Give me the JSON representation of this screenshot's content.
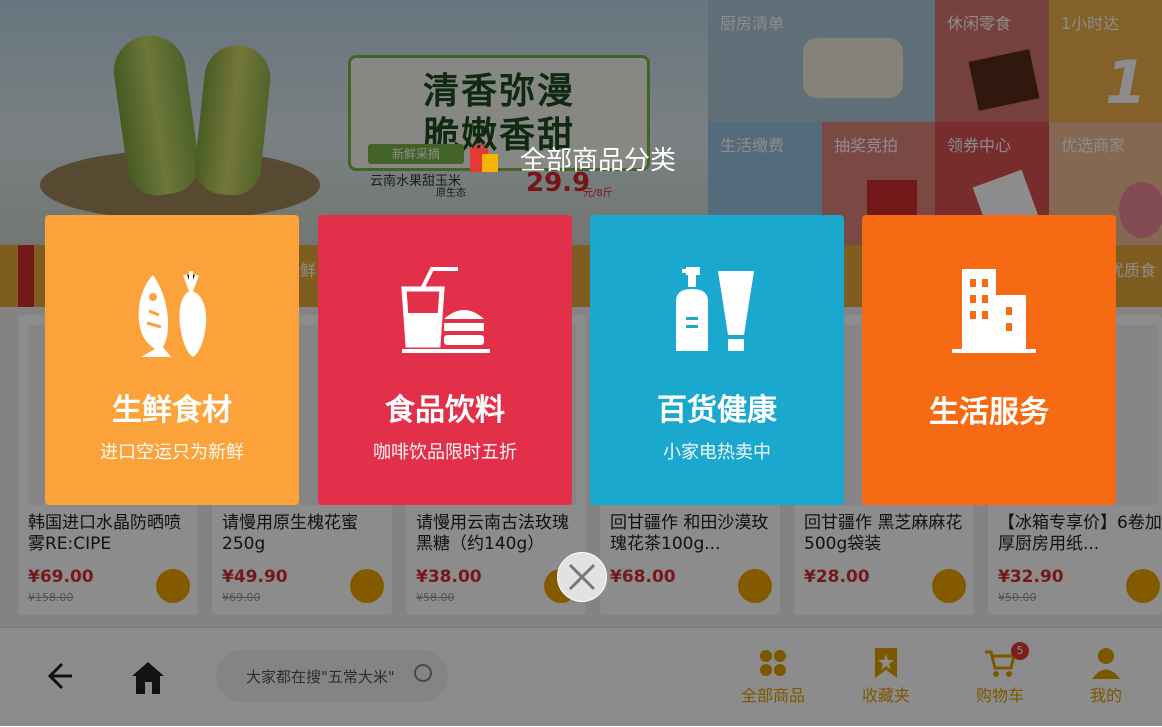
{
  "banner": {
    "headline1": "清香弥漫",
    "headline2": "脆嫩香甜",
    "tag": "新鲜采摘",
    "product": "云南水果甜玉米",
    "origin": "原生态",
    "price": "29.9",
    "unit": "元/8斤"
  },
  "tiles": [
    {
      "label": "厨房清单"
    },
    {
      "label": "休闲零食"
    },
    {
      "label": "1小时达"
    },
    {
      "label": "生活缴费"
    },
    {
      "label": "抽奖竞拍"
    },
    {
      "label": "领券中心"
    },
    {
      "label": "优选商家"
    }
  ],
  "strip": {
    "left_text": "新鲜",
    "right_text": "优质食"
  },
  "products": [
    {
      "name": "韩国进口水晶防晒喷雾RE:CIPE",
      "price": "¥69.00",
      "old_price": "¥158.00"
    },
    {
      "name": "请慢用原生槐花蜜250g",
      "price": "¥49.90",
      "old_price": "¥69.00"
    },
    {
      "name": "请慢用云南古法玫瑰黑糖（约140g）",
      "price": "¥38.00",
      "old_price": "¥58.00"
    },
    {
      "name": "回甘疆作 和田沙漠玫瑰花茶100g...",
      "price": "¥68.00",
      "old_price": ""
    },
    {
      "name": "回甘疆作 黑芝麻麻花 500g袋装",
      "price": "¥28.00",
      "old_price": ""
    },
    {
      "name": "【冰箱专享价】6卷加厚厨房用纸...",
      "price": "¥32.90",
      "old_price": "¥50.00"
    }
  ],
  "bottom": {
    "search_placeholder": "大家都在搜\"五常大米\"",
    "nav": [
      {
        "label": "全部商品",
        "icon": "grid-icon"
      },
      {
        "label": "收藏夹",
        "icon": "bookmark-icon"
      },
      {
        "label": "购物车",
        "icon": "cart-icon",
        "badge": "5"
      },
      {
        "label": "我的",
        "icon": "user-icon"
      }
    ]
  },
  "overlay": {
    "title": "全部商品分类",
    "categories": [
      {
        "name": "生鲜食材",
        "sub": "进口空运只为新鲜",
        "color": "#fba33a",
        "icon": "fish-carrot-icon"
      },
      {
        "name": "食品饮料",
        "sub": "咖啡饮品限时五折",
        "color": "#e3304a",
        "icon": "drink-burger-icon"
      },
      {
        "name": "百货健康",
        "sub": "小家电热卖中",
        "color": "#1aa8cf",
        "icon": "bottles-icon"
      },
      {
        "name": "生活服务",
        "sub": "",
        "color": "#f56a13",
        "icon": "building-icon"
      }
    ]
  },
  "colors": {
    "accent": "#f0a400",
    "price": "#d32f2f"
  }
}
